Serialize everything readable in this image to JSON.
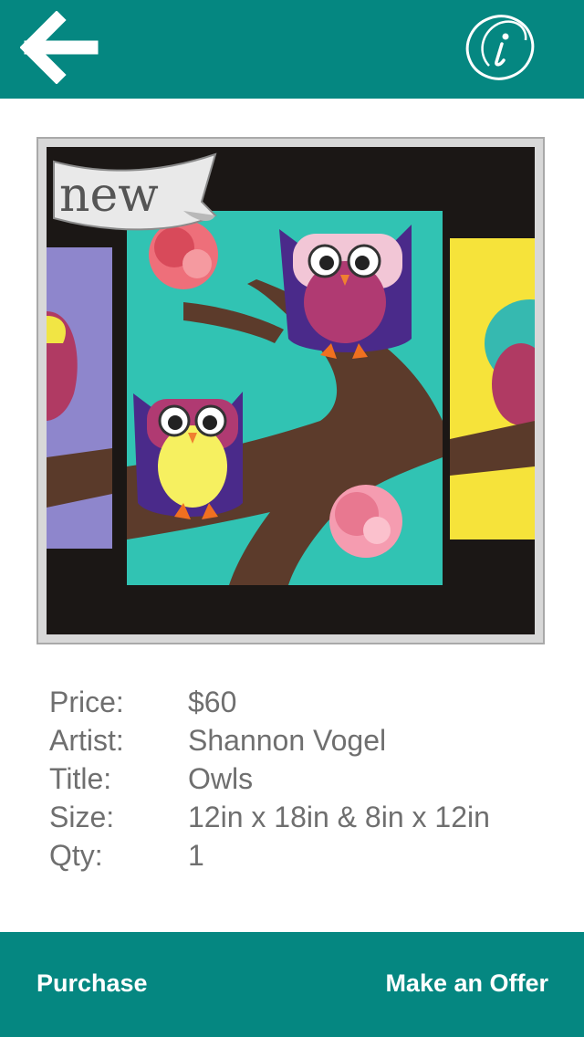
{
  "colors": {
    "brand": "#058781",
    "label_text": "#6f6f6f",
    "button_text": "#ffffff"
  },
  "header": {
    "back_icon": "arrow-left-icon",
    "info_icon": "info-circle-icon"
  },
  "artwork": {
    "image": "owl-paintings-photo",
    "badge": "new"
  },
  "details": [
    {
      "label": "Price:",
      "value": "$60"
    },
    {
      "label": "Artist:",
      "value": "Shannon Vogel"
    },
    {
      "label": "Title:",
      "value": "Owls"
    },
    {
      "label": "Size:",
      "value": "12in x 18in & 8in x 12in"
    },
    {
      "label": "Qty:",
      "value": "1"
    }
  ],
  "footer": {
    "purchase_label": "Purchase",
    "offer_label": "Make an Offer"
  }
}
